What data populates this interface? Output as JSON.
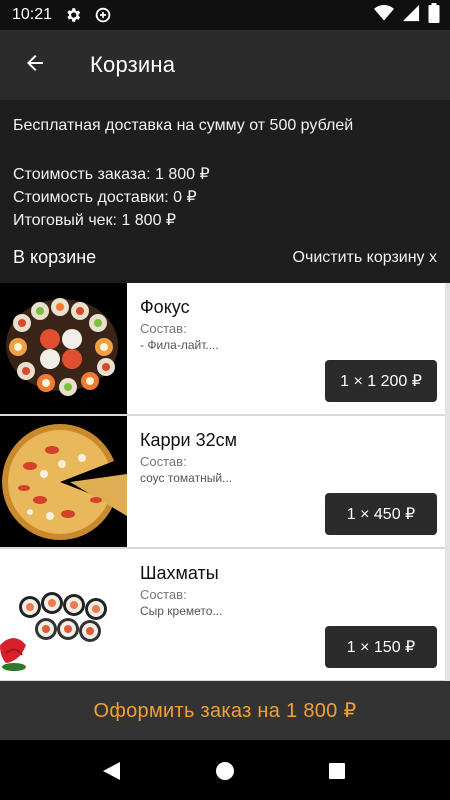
{
  "status_bar": {
    "time": "10:21"
  },
  "app_bar": {
    "title": "Корзина"
  },
  "info": {
    "free_delivery": "Бесплатная доставка на сумму от 500 рублей",
    "order_cost": "Стоимость заказа: 1 800 ₽",
    "delivery_cost": "Стоимость доставки: 0 ₽",
    "total": "Итоговый чек: 1 800 ₽",
    "in_cart": "В корзине",
    "clear_cart": "Очистить корзину x"
  },
  "items": [
    {
      "name": "Фокус",
      "composition_label": "Состав:",
      "composition": "- Фила-лайт....",
      "quantity_price": "1 × 1 200 ₽"
    },
    {
      "name": "Карри 32см",
      "composition_label": "Состав:",
      "composition": "соус томатный...",
      "quantity_price": "1 × 450 ₽"
    },
    {
      "name": "Шахматы",
      "composition_label": "Состав:",
      "composition": "Сыр кремето...",
      "quantity_price": "1 × 150 ₽"
    }
  ],
  "checkout": {
    "label": "Оформить заказ на 1 800 ₽"
  },
  "colors": {
    "accent": "#f2a034",
    "background": "#1f1f1f",
    "appbar": "#2b2b2b"
  }
}
